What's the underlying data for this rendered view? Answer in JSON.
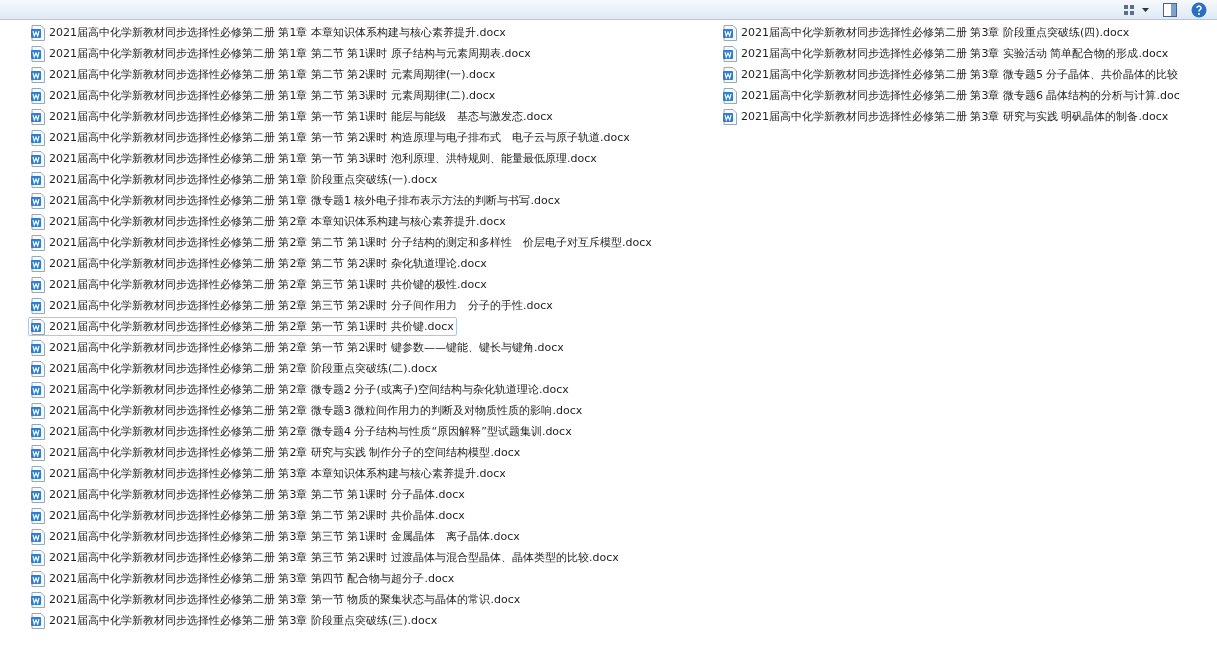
{
  "files": [
    {
      "name": "2021届高中化学新教材同步选择性必修第二册 第1章 本章知识体系构建与核心素养提升.docx",
      "focused": false
    },
    {
      "name": "2021届高中化学新教材同步选择性必修第二册 第1章 第二节 第1课时 原子结构与元素周期表.docx",
      "focused": false
    },
    {
      "name": "2021届高中化学新教材同步选择性必修第二册 第1章 第二节 第2课时 元素周期律(一).docx",
      "focused": false
    },
    {
      "name": "2021届高中化学新教材同步选择性必修第二册 第1章 第二节 第3课时 元素周期律(二).docx",
      "focused": false
    },
    {
      "name": "2021届高中化学新教材同步选择性必修第二册 第1章 第一节 第1课时 能层与能级　基态与激发态.docx",
      "focused": false
    },
    {
      "name": "2021届高中化学新教材同步选择性必修第二册 第1章 第一节 第2课时 构造原理与电子排布式　电子云与原子轨道.docx",
      "focused": false
    },
    {
      "name": "2021届高中化学新教材同步选择性必修第二册 第1章 第一节 第3课时 泡利原理、洪特规则、能量最低原理.docx",
      "focused": false
    },
    {
      "name": "2021届高中化学新教材同步选择性必修第二册 第1章 阶段重点突破练(一).docx",
      "focused": false
    },
    {
      "name": "2021届高中化学新教材同步选择性必修第二册 第1章 微专题1 核外电子排布表示方法的判断与书写.docx",
      "focused": false
    },
    {
      "name": "2021届高中化学新教材同步选择性必修第二册 第2章 本章知识体系构建与核心素养提升.docx",
      "focused": false
    },
    {
      "name": "2021届高中化学新教材同步选择性必修第二册 第2章 第二节 第1课时 分子结构的测定和多样性　价层电子对互斥模型.docx",
      "focused": false
    },
    {
      "name": "2021届高中化学新教材同步选择性必修第二册 第2章 第二节 第2课时 杂化轨道理论.docx",
      "focused": false
    },
    {
      "name": "2021届高中化学新教材同步选择性必修第二册 第2章 第三节 第1课时 共价键的极性.docx",
      "focused": false
    },
    {
      "name": "2021届高中化学新教材同步选择性必修第二册 第2章 第三节 第2课时 分子间作用力　分子的手性.docx",
      "focused": false
    },
    {
      "name": "2021届高中化学新教材同步选择性必修第二册 第2章 第一节 第1课时 共价键.docx",
      "focused": true
    },
    {
      "name": "2021届高中化学新教材同步选择性必修第二册 第2章 第一节 第2课时 键参数——键能、键长与键角.docx",
      "focused": false
    },
    {
      "name": "2021届高中化学新教材同步选择性必修第二册 第2章 阶段重点突破练(二).docx",
      "focused": false
    },
    {
      "name": "2021届高中化学新教材同步选择性必修第二册 第2章 微专题2 分子(或离子)空间结构与杂化轨道理论.docx",
      "focused": false
    },
    {
      "name": "2021届高中化学新教材同步选择性必修第二册 第2章 微专题3 微粒间作用力的判断及对物质性质的影响.docx",
      "focused": false
    },
    {
      "name": "2021届高中化学新教材同步选择性必修第二册 第2章 微专题4 分子结构与性质“原因解释”型试题集训.docx",
      "focused": false
    },
    {
      "name": "2021届高中化学新教材同步选择性必修第二册 第2章 研究与实践 制作分子的空间结构模型.docx",
      "focused": false
    },
    {
      "name": "2021届高中化学新教材同步选择性必修第二册 第3章 本章知识体系构建与核心素养提升.docx",
      "focused": false
    },
    {
      "name": "2021届高中化学新教材同步选择性必修第二册 第3章 第二节 第1课时 分子晶体.docx",
      "focused": false
    },
    {
      "name": "2021届高中化学新教材同步选择性必修第二册 第3章 第二节 第2课时 共价晶体.docx",
      "focused": false
    },
    {
      "name": "2021届高中化学新教材同步选择性必修第二册 第3章 第三节 第1课时 金属晶体　离子晶体.docx",
      "focused": false
    },
    {
      "name": "2021届高中化学新教材同步选择性必修第二册 第3章 第三节 第2课时 过渡晶体与混合型晶体、晶体类型的比较.docx",
      "focused": false
    },
    {
      "name": "2021届高中化学新教材同步选择性必修第二册 第3章 第四节 配合物与超分子.docx",
      "focused": false
    },
    {
      "name": "2021届高中化学新教材同步选择性必修第二册 第3章 第一节 物质的聚集状态与晶体的常识.docx",
      "focused": false
    },
    {
      "name": "2021届高中化学新教材同步选择性必修第二册 第3章 阶段重点突破练(三).docx",
      "focused": false
    },
    {
      "name": "2021届高中化学新教材同步选择性必修第二册 第3章 阶段重点突破练(四).docx",
      "focused": false
    },
    {
      "name": "2021届高中化学新教材同步选择性必修第二册 第3章 实验活动 简单配合物的形成.docx",
      "focused": false
    },
    {
      "name": "2021届高中化学新教材同步选择性必修第二册 第3章 微专题5 分子晶体、共价晶体的比较",
      "focused": false
    },
    {
      "name": "2021届高中化学新教材同步选择性必修第二册 第3章 微专题6 晶体结构的分析与计算.doc",
      "focused": false
    },
    {
      "name": "2021届高中化学新教材同步选择性必修第二册 第3章 研究与实践 明矾晶体的制备.docx",
      "focused": false
    }
  ]
}
